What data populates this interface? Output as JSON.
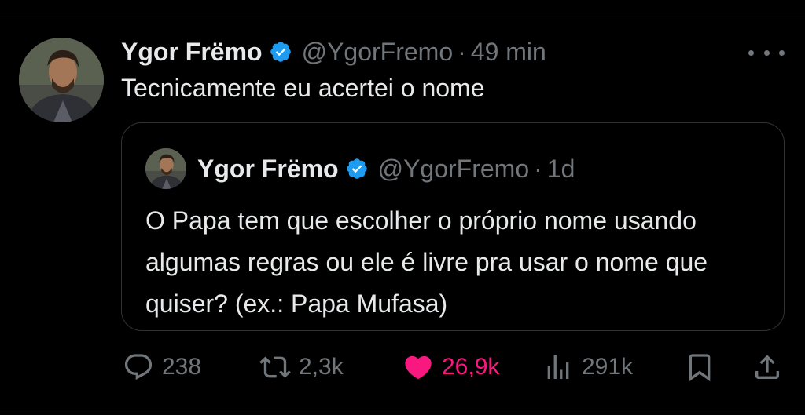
{
  "tweet": {
    "author_name": "Ygor Frëmo",
    "handle": "@YgorFremo",
    "separator": "·",
    "time": "49 min",
    "text": "Tecnicamente eu acertei o nome"
  },
  "quoted_tweet": {
    "author_name": "Ygor Frëmo",
    "handle": "@YgorFremo",
    "separator": "·",
    "time": "1d",
    "text": "O Papa tem que escolher o próprio nome usando algumas regras ou ele é livre pra usar o nome que quiser? (ex.: Papa Mufasa)"
  },
  "actions": {
    "replies": "238",
    "reposts": "2,3k",
    "likes": "26,9k",
    "views": "291k"
  },
  "colors": {
    "background": "#000000",
    "text": "#e7e9ea",
    "muted": "#71767b",
    "verified": "#1d9bf0",
    "like": "#f91880"
  },
  "icons": {
    "verified": "verified-badge-icon",
    "more": "more-options-icon",
    "reply": "reply-icon",
    "repost": "repost-icon",
    "like": "heart-icon",
    "views": "views-icon",
    "bookmark": "bookmark-icon",
    "share": "share-icon"
  }
}
